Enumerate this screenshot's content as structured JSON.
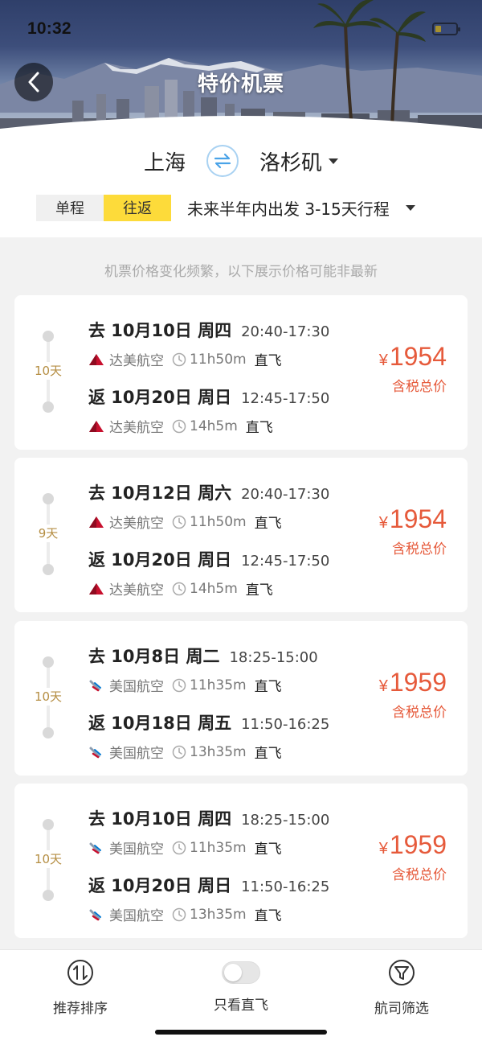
{
  "status": {
    "time": "10:32"
  },
  "header": {
    "title": "特价机票"
  },
  "route": {
    "from": "上海",
    "to": "洛杉矶"
  },
  "trip": {
    "one_way": "单程",
    "round_trip": "往返",
    "selected": "往返",
    "range": "未来半年内出发 3-15天行程"
  },
  "notice": "机票价格变化频繁，以下展示价格可能非最新",
  "colors": {
    "price": "#e65a3b",
    "selected_tab": "#fddb3a",
    "days": "#b58e43"
  },
  "flights": [
    {
      "days": "10天",
      "out": {
        "date": "去 10月10日 周四",
        "time": "20:40-17:30",
        "airline": "达美航空",
        "airline_icon": "delta-logo-icon",
        "duration": "11h50m",
        "type": "直飞"
      },
      "ret": {
        "date": "返 10月20日 周日",
        "time": "12:45-17:50",
        "airline": "达美航空",
        "airline_icon": "delta-logo-icon",
        "duration": "14h5m",
        "type": "直飞"
      },
      "price_symbol": "¥",
      "price": "1954",
      "price_note": "含税总价"
    },
    {
      "days": "9天",
      "out": {
        "date": "去 10月12日 周六",
        "time": "20:40-17:30",
        "airline": "达美航空",
        "airline_icon": "delta-logo-icon",
        "duration": "11h50m",
        "type": "直飞"
      },
      "ret": {
        "date": "返 10月20日 周日",
        "time": "12:45-17:50",
        "airline": "达美航空",
        "airline_icon": "delta-logo-icon",
        "duration": "14h5m",
        "type": "直飞"
      },
      "price_symbol": "¥",
      "price": "1954",
      "price_note": "含税总价"
    },
    {
      "days": "10天",
      "out": {
        "date": "去 10月8日 周二",
        "time": "18:25-15:00",
        "airline": "美国航空",
        "airline_icon": "american-airlines-logo-icon",
        "duration": "11h35m",
        "type": "直飞"
      },
      "ret": {
        "date": "返 10月18日 周五",
        "time": "11:50-16:25",
        "airline": "美国航空",
        "airline_icon": "american-airlines-logo-icon",
        "duration": "13h35m",
        "type": "直飞"
      },
      "price_symbol": "¥",
      "price": "1959",
      "price_note": "含税总价"
    },
    {
      "days": "10天",
      "out": {
        "date": "去 10月10日 周四",
        "time": "18:25-15:00",
        "airline": "美国航空",
        "airline_icon": "american-airlines-logo-icon",
        "duration": "11h35m",
        "type": "直飞"
      },
      "ret": {
        "date": "返 10月20日 周日",
        "time": "11:50-16:25",
        "airline": "美国航空",
        "airline_icon": "american-airlines-logo-icon",
        "duration": "13h35m",
        "type": "直飞"
      },
      "price_symbol": "¥",
      "price": "1959",
      "price_note": "含税总价"
    }
  ],
  "bottom": {
    "sort": "推荐排序",
    "direct_only": "只看直飞",
    "direct_only_on": false,
    "filter": "航司筛选"
  }
}
